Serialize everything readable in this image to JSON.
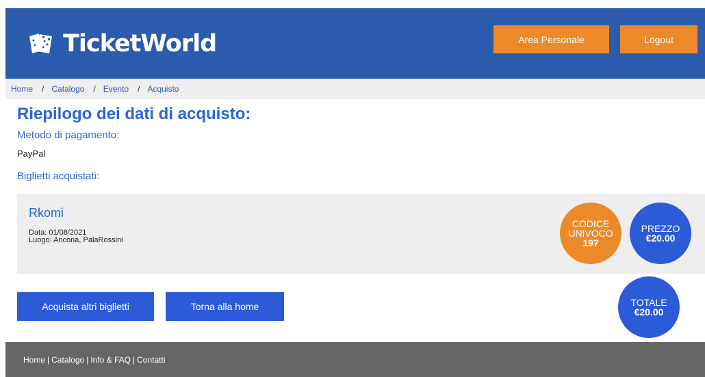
{
  "header": {
    "logo_text": "TicketWorld",
    "area_personale": "Area Personale",
    "logout": "Logout"
  },
  "breadcrumb": {
    "items": [
      "Home",
      "Catalogo",
      "Evento",
      "Acquisto"
    ],
    "separator": "/"
  },
  "main": {
    "title": "Riepilogo dei dati di acquisto:",
    "payment_label": "Metodo di pagamento:",
    "payment_value": "PayPal",
    "tickets_label": "Biglietti acquistati:"
  },
  "ticket": {
    "name": "Rkomi",
    "date": "Data: 01/08/2021",
    "place": "Luogo: Ancona, PalaRossini",
    "codice_label_1": "CODICE",
    "codice_label_2": "UNIVOCO",
    "codice_value": "197",
    "prezzo_label": "PREZZO",
    "prezzo_value": "€20.00"
  },
  "total": {
    "label": "TOTALE",
    "value": "€20.00"
  },
  "actions": {
    "buy_more": "Acquista altri biglietti",
    "back_home": "Torna alla home"
  },
  "footer": {
    "links": [
      "Home",
      "Catalogo",
      "Info & FAQ",
      "Contatti"
    ],
    "separator": "|"
  },
  "colors": {
    "brand_blue": "#2b5bac",
    "accent_orange": "#ec8a2a",
    "button_blue": "#2b5bd6"
  },
  "icons": {
    "logo": "tickets-icon"
  }
}
